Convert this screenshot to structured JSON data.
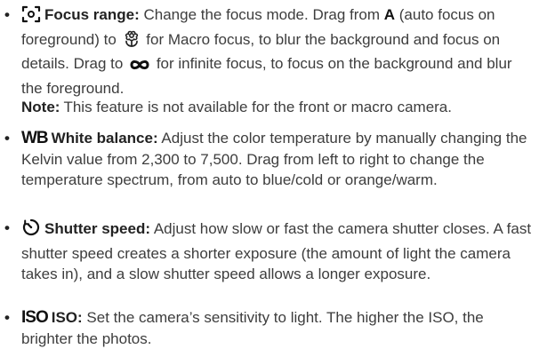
{
  "items": [
    {
      "icon": "focus-range-icon",
      "term": "Focus range:",
      "text_part1": "Change the focus mode. Drag from",
      "bold_A": "A",
      "text_part2": "(auto focus on foreground) to",
      "macro_icon": "flower-macro-icon",
      "text_part3": "for Macro focus, to blur the background and focus on details. Drag to",
      "infinity_icon": "infinity-icon",
      "text_part4": "for infinite focus, to focus on the background and blur the foreground."
    },
    {
      "icon": "white-balance-icon",
      "icon_text": "WB",
      "term": "White balance:",
      "text": "Adjust the color temperature by manually changing the Kelvin value from 2,300 to 7,500. Drag from left to right to change the temperature spectrum, from auto to blue/cold or orange/warm."
    },
    {
      "icon": "shutter-speed-icon",
      "term": "Shutter speed:",
      "text": "Adjust how slow or fast the camera shutter closes. A fast shutter speed creates a shorter exposure (the amount of light the camera takes in), and a slow shutter speed allows a longer exposure."
    },
    {
      "icon": "iso-icon",
      "icon_text": "ISO",
      "term": "ISO:",
      "text": "Set the camera’s sensitivity to light. The higher the ISO, the brighter the photos."
    }
  ],
  "note": {
    "label": "Note:",
    "text": "This feature is not available for the front or macro camera."
  },
  "bullet_char": "•"
}
